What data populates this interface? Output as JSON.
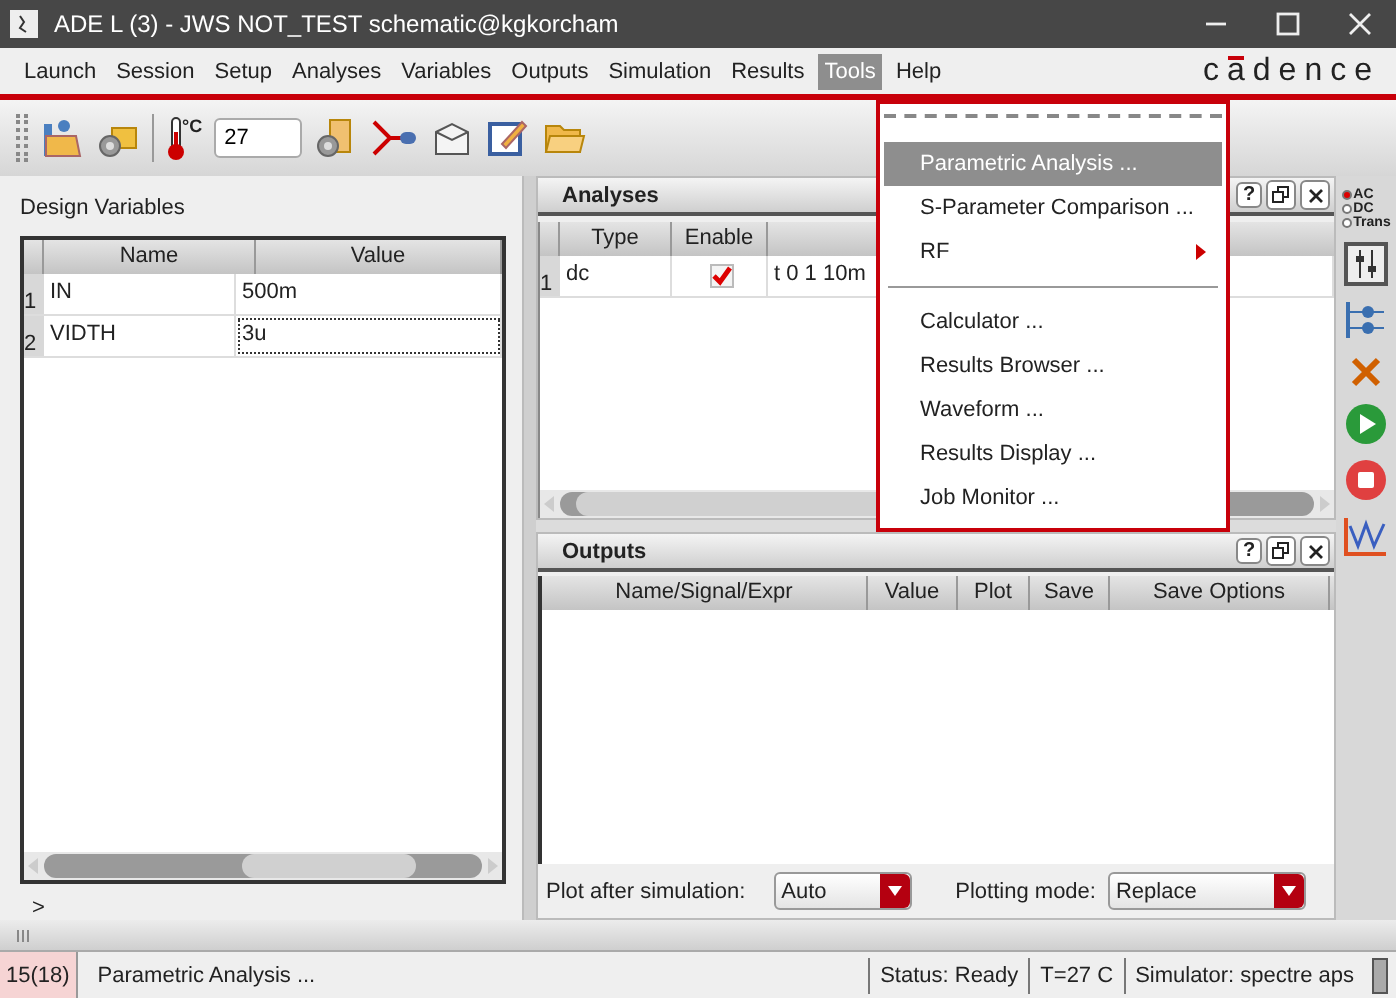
{
  "window": {
    "title": "ADE L (3) - JWS NOT_TEST schematic@kgkorcham"
  },
  "menu_bar": [
    {
      "label": "Launch",
      "selected": false
    },
    {
      "label": "Session",
      "selected": false
    },
    {
      "label": "Setup",
      "selected": false
    },
    {
      "label": "Analyses",
      "selected": false
    },
    {
      "label": "Variables",
      "selected": false
    },
    {
      "label": "Outputs",
      "selected": false
    },
    {
      "label": "Simulation",
      "selected": false
    },
    {
      "label": "Results",
      "selected": false
    },
    {
      "label": "Tools",
      "selected": true
    },
    {
      "label": "Help",
      "selected": false
    }
  ],
  "logo": "cadence",
  "toolbar": {
    "temperature_unit": "°C",
    "temperature": "27"
  },
  "design_variables": {
    "title": "Design Variables",
    "columns": [
      "Name",
      "Value"
    ],
    "rows": [
      {
        "index": "1",
        "name": "IN",
        "value": "500m",
        "focused": false
      },
      {
        "index": "2",
        "name": "VIDTH",
        "value": "3u",
        "focused": true
      }
    ],
    "prompt": ">"
  },
  "analyses": {
    "title": "Analyses",
    "help": "?",
    "columns": [
      "Type",
      "Enable"
    ],
    "rows": [
      {
        "index": "1",
        "type": "dc",
        "enabled": true,
        "arguments": "t 0 1 10m"
      }
    ]
  },
  "outputs": {
    "title": "Outputs",
    "help": "?",
    "columns": [
      "Name/Signal/Expr",
      "Value",
      "Plot",
      "Save",
      "Save Options"
    ],
    "plot_after_simulation": {
      "label": "Plot after simulation:",
      "value": "Auto"
    },
    "plotting_mode": {
      "label": "Plotting mode:",
      "value": "Replace"
    }
  },
  "analysis_choices": [
    {
      "label": "AC",
      "selected": true
    },
    {
      "label": "DC",
      "selected": false
    },
    {
      "label": "Trans",
      "selected": false
    }
  ],
  "tools_menu": [
    {
      "kind": "tearoff"
    },
    {
      "kind": "item",
      "label": "Parametric Analysis ...",
      "selected": true
    },
    {
      "kind": "item",
      "label": "S-Parameter Comparison ...",
      "selected": false
    },
    {
      "kind": "submenu",
      "label": "RF",
      "selected": false
    },
    {
      "kind": "separator"
    },
    {
      "kind": "item",
      "label": "Calculator ...",
      "selected": false
    },
    {
      "kind": "item",
      "label": "Results Browser ...",
      "selected": false
    },
    {
      "kind": "item",
      "label": "Waveform ...",
      "selected": false
    },
    {
      "kind": "item",
      "label": "Results Display ...",
      "selected": false
    },
    {
      "kind": "item",
      "label": "Job Monitor ...",
      "selected": false
    }
  ],
  "status_bar": {
    "line_number": "15(18)",
    "message": "Parametric Analysis ...",
    "status": "Status: Ready",
    "temperature": "T=27 C",
    "simulator": "Simulator: spectre aps"
  }
}
